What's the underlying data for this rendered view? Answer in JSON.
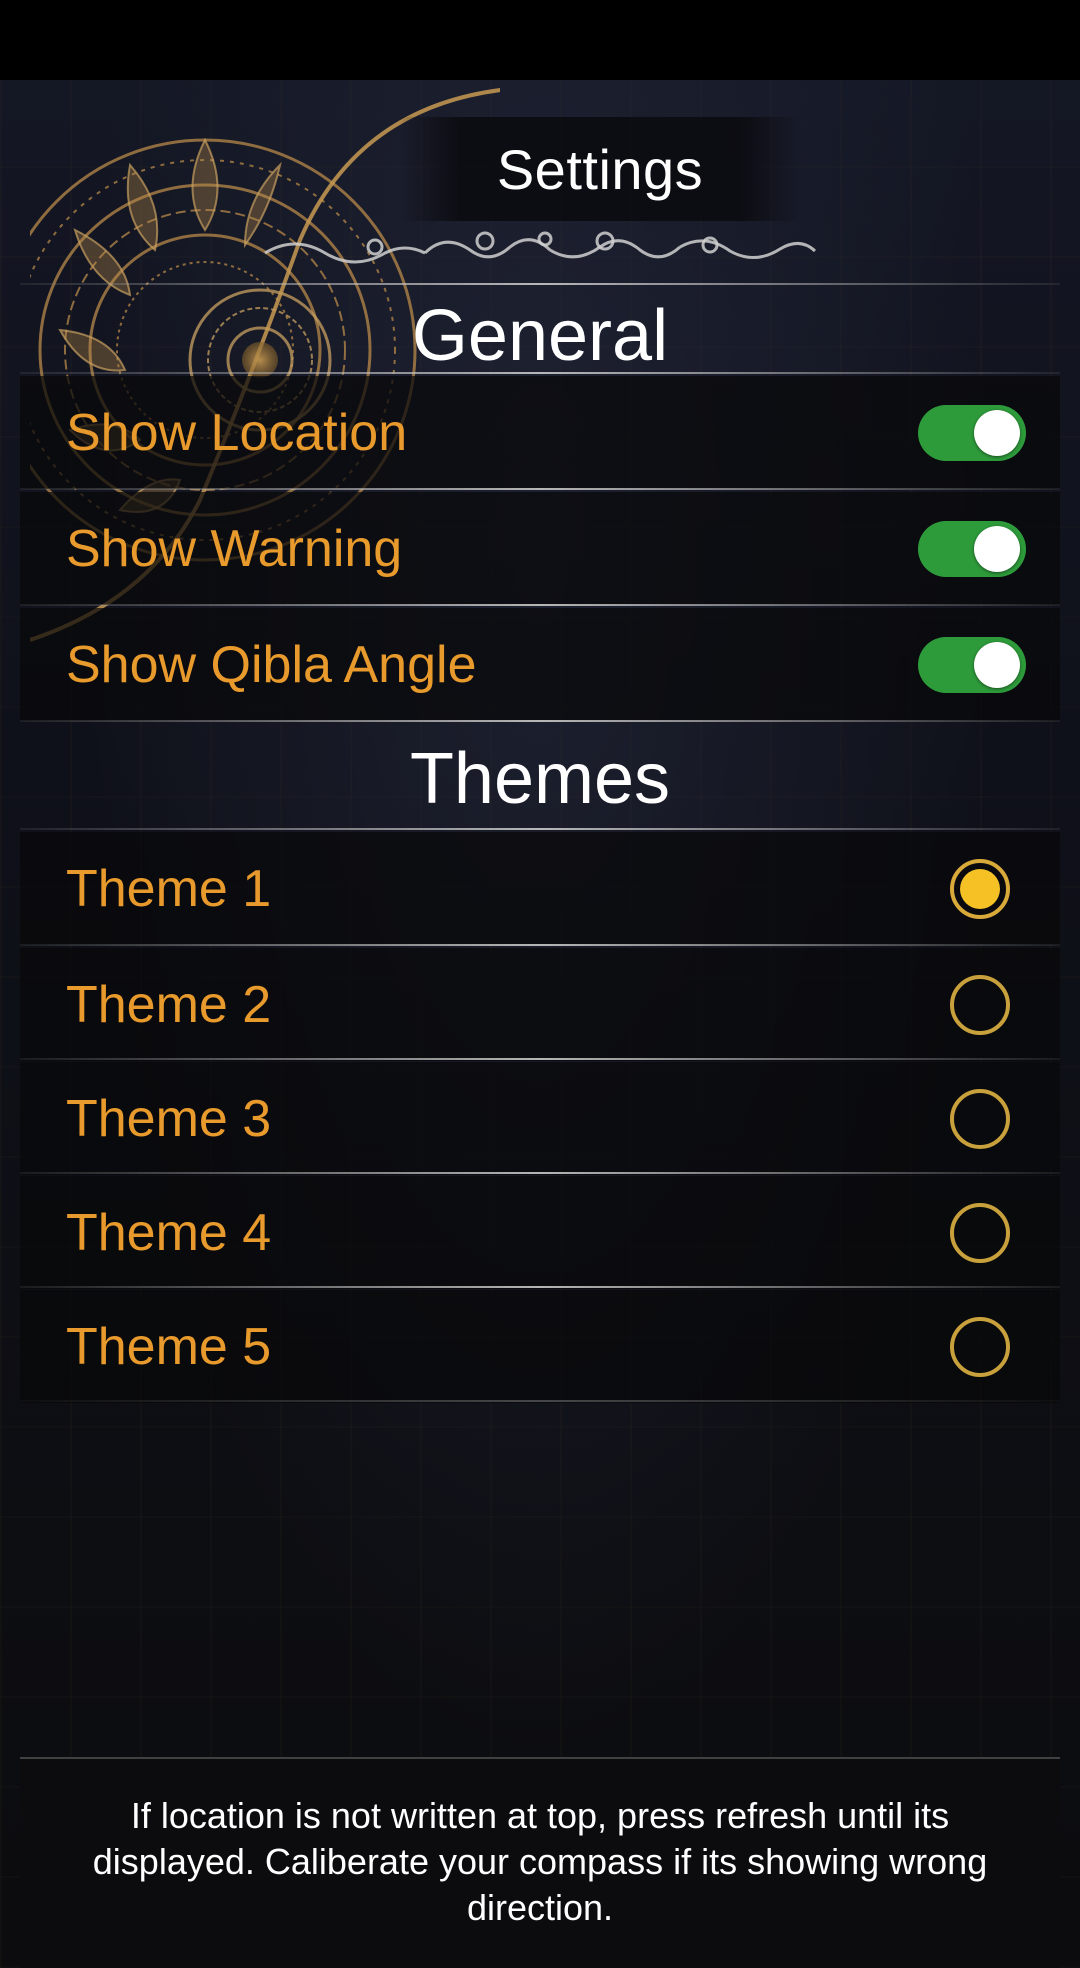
{
  "header": {
    "title": "Settings"
  },
  "general": {
    "heading": "General",
    "items": [
      {
        "label": "Show Location",
        "enabled": true
      },
      {
        "label": "Show Warning",
        "enabled": true
      },
      {
        "label": "Show Qibla Angle",
        "enabled": true
      }
    ]
  },
  "themes": {
    "heading": "Themes",
    "items": [
      {
        "label": "Theme 1",
        "selected": true
      },
      {
        "label": "Theme 2",
        "selected": false
      },
      {
        "label": "Theme 3",
        "selected": false
      },
      {
        "label": "Theme 4",
        "selected": false
      },
      {
        "label": "Theme 5",
        "selected": false
      }
    ]
  },
  "footer": {
    "note": "If location is not written at top, press refresh until its displayed. Caliberate your compass if its showing wrong direction."
  },
  "colors": {
    "accent_gold": "#e89a2c",
    "toggle_on": "#2e9b3b",
    "radio_fill": "#f5c125"
  },
  "icons": {
    "ornament": "mandala-ornament-icon",
    "flourish": "scroll-flourish-icon"
  }
}
